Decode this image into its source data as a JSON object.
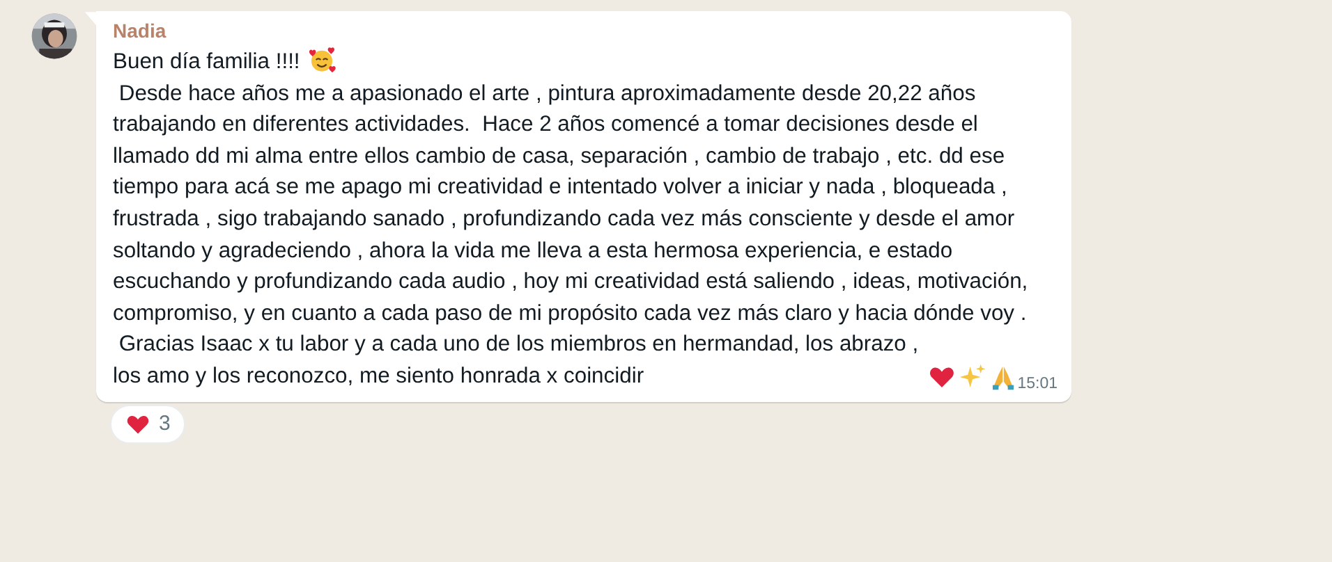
{
  "message": {
    "sender": "Nadia",
    "paragraphs": [
      "Buen día familia !!!!",
      " Desde hace años me a apasionado el arte , pintura aproximadamente desde 20,22 años trabajando en diferentes actividades.  Hace 2 años comencé a tomar decisiones desde el llamado dd mi alma entre ellos cambio de casa, separación , cambio de trabajo , etc. dd ese tiempo para acá se me apago mi creatividad e intentado volver a iniciar y nada , bloqueada , frustrada , sigo trabajando sanado , profundizando cada vez más consciente y desde el amor soltando y agradeciendo , ahora la vida me lleva a esta hermosa experiencia, e estado escuchando y profundizando cada audio , hoy mi creatividad está saliendo , ideas, motivación, compromiso, y en cuanto a cada paso de mi propósito cada vez más claro y hacia dónde voy .",
      " Gracias Isaac x tu labor y a cada uno de los miembros en hermandad, los abrazo , los amo y los reconozco, me siento honrada x coincidir"
    ],
    "time": "15:01",
    "reaction": {
      "count": "3"
    }
  }
}
